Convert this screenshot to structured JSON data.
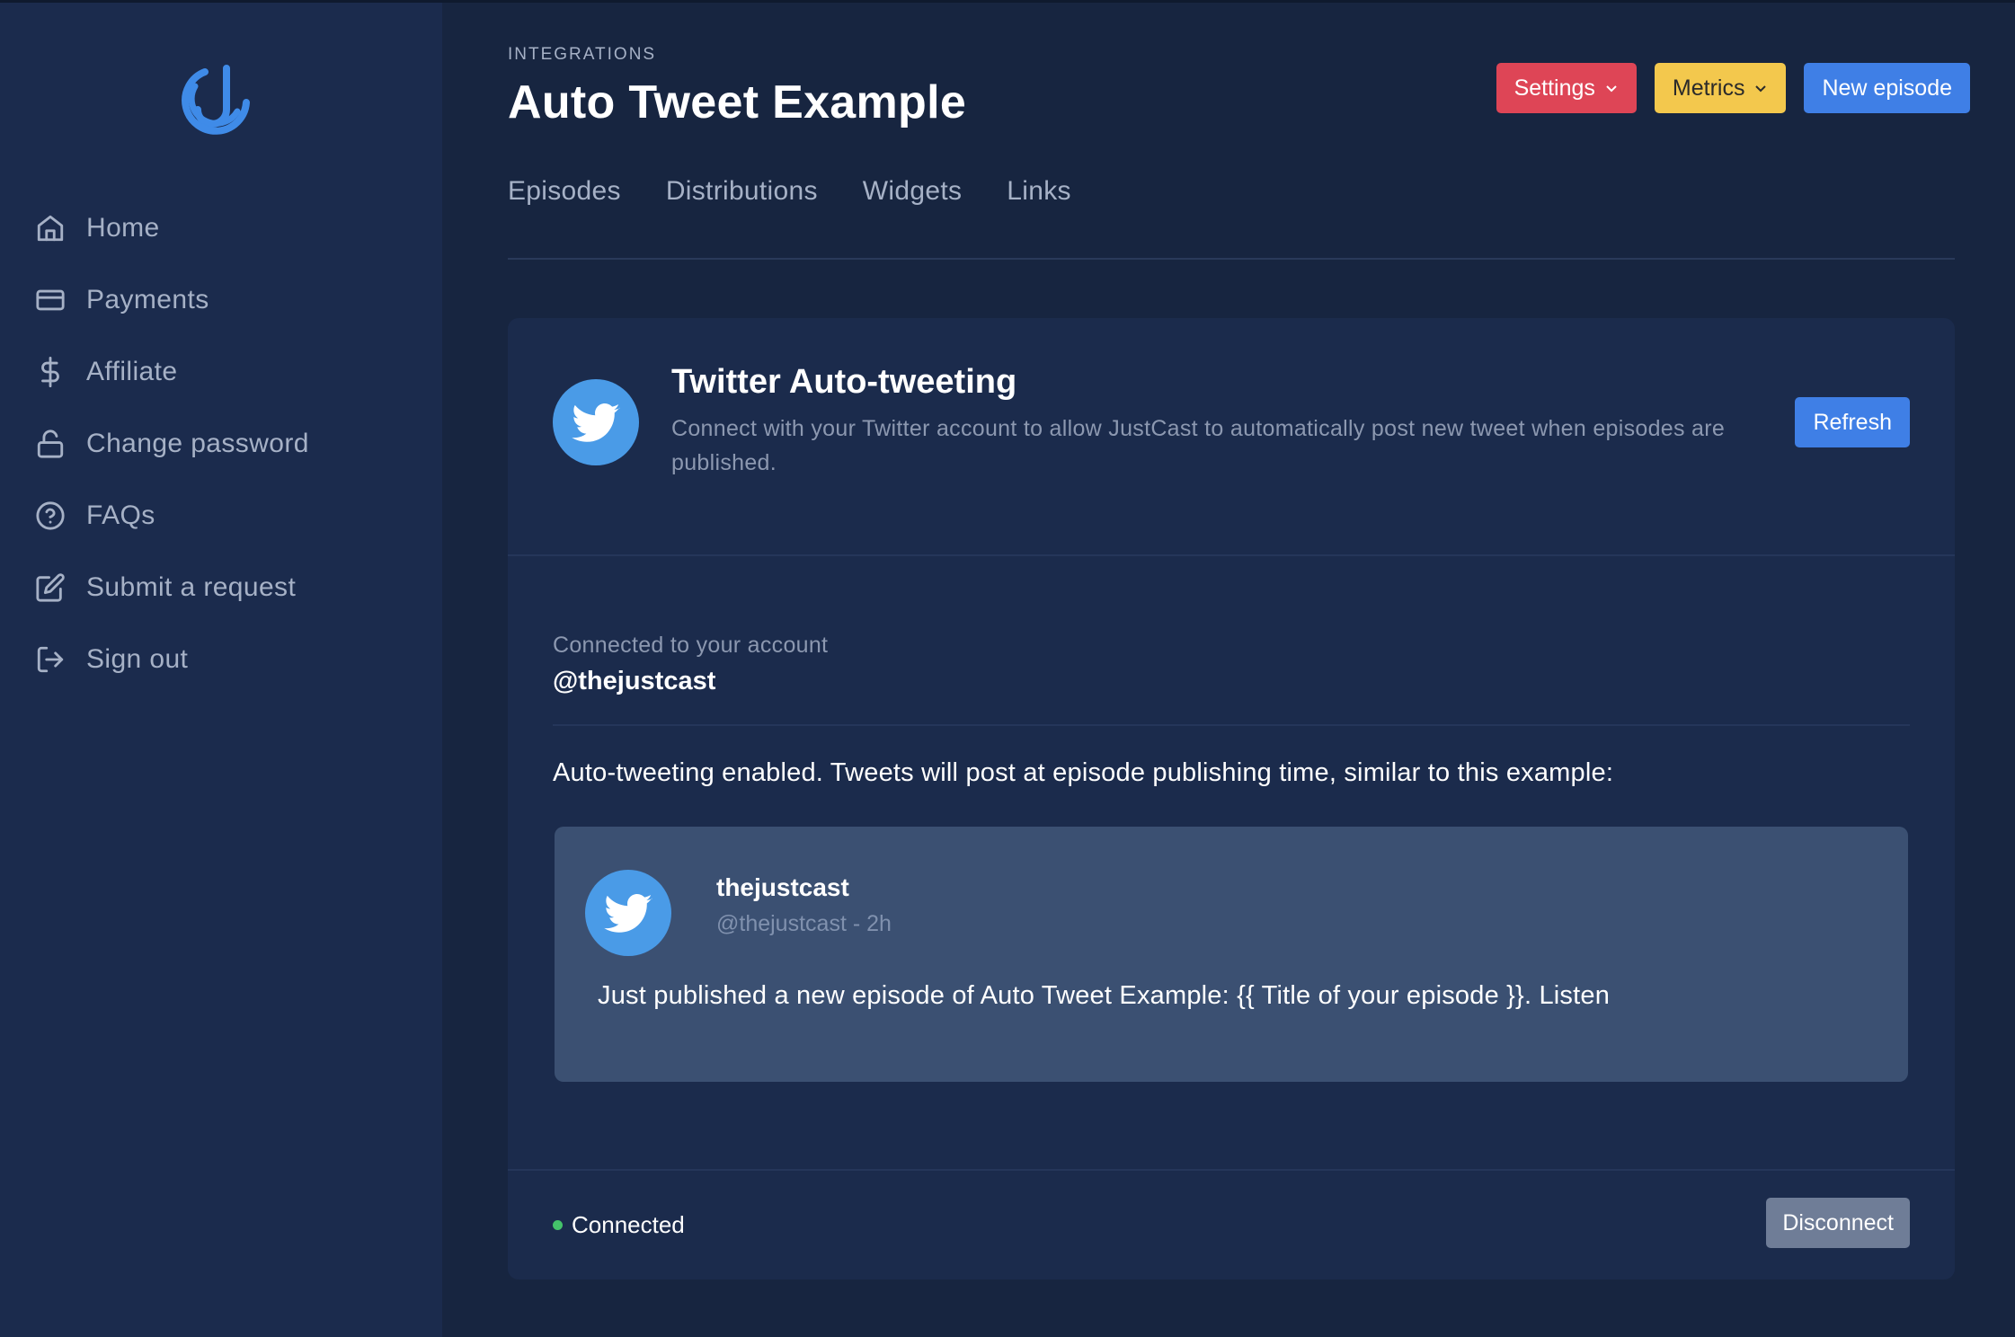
{
  "colors": {
    "sidebar_bg": "#1b2b4d",
    "main_bg": "#172540",
    "card_bg": "#1b2b4c",
    "tweet_bg": "#3b5072",
    "settings_btn": "#de4556",
    "metrics_btn": "#f3c84d",
    "primary_btn": "#3f7fe6",
    "disconnect_btn": "#6f7d97",
    "twitter_blue": "#4a9be7",
    "connected_dot": "#44c26a"
  },
  "sidebar": {
    "logo_icon": "justcast-logo-icon",
    "items": [
      {
        "label": "Home",
        "icon": "home-icon"
      },
      {
        "label": "Payments",
        "icon": "credit-card-icon"
      },
      {
        "label": "Affiliate",
        "icon": "dollar-icon"
      },
      {
        "label": "Change password",
        "icon": "unlock-icon"
      },
      {
        "label": "FAQs",
        "icon": "question-circle-icon"
      },
      {
        "label": "Submit a request",
        "icon": "edit-icon"
      },
      {
        "label": "Sign out",
        "icon": "sign-out-icon"
      }
    ]
  },
  "header": {
    "breadcrumb": "INTEGRATIONS",
    "title": "Auto Tweet Example",
    "settings_label": "Settings",
    "metrics_label": "Metrics",
    "new_episode_label": "New episode"
  },
  "tabs": [
    "Episodes",
    "Distributions",
    "Widgets",
    "Links"
  ],
  "card": {
    "title": "Twitter Auto-tweeting",
    "description": "Connect with your Twitter account to allow JustCast to automatically post new tweet when episodes are published.",
    "refresh_label": "Refresh",
    "connected_label": "Connected to your account",
    "handle": "@thejustcast",
    "enabled_text": "Auto-tweeting enabled. Tweets will post at episode publishing time, similar to this example:",
    "tweet": {
      "name": "thejustcast",
      "meta": "@thejustcast - 2h",
      "body": "Just published a new episode of Auto Tweet Example: {{ Title of your episode }}. Listen"
    },
    "status_text": "Connected",
    "disconnect_label": "Disconnect"
  }
}
